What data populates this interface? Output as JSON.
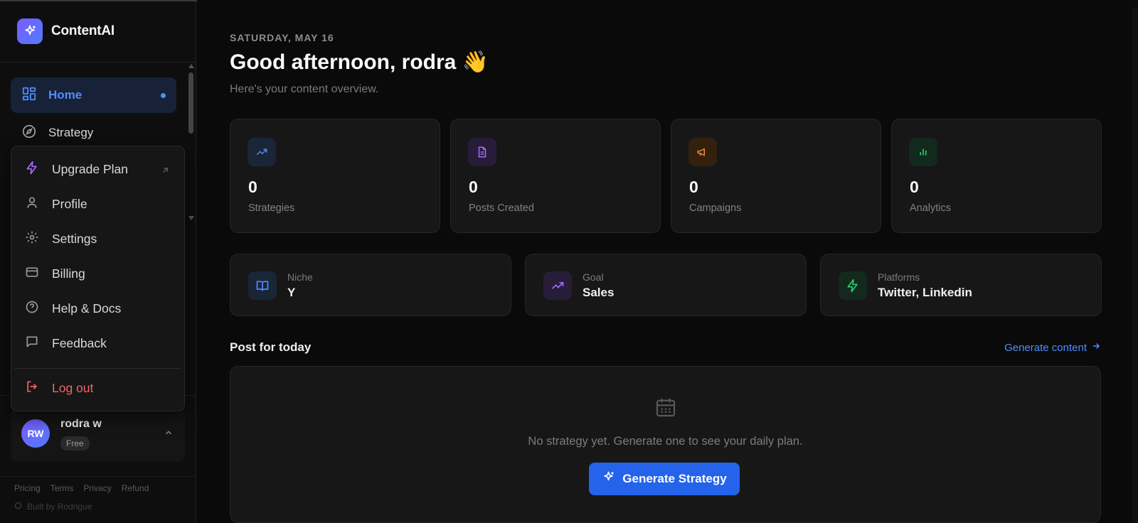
{
  "brand": {
    "name": "ContentAI",
    "logo_icon": "sparkles-icon"
  },
  "nav": {
    "items": [
      {
        "label": "Home",
        "icon": "layout-grid-icon",
        "active": true
      },
      {
        "label": "Strategy",
        "icon": "compass-icon",
        "active": false
      }
    ]
  },
  "menu": {
    "items": [
      {
        "label": "Upgrade Plan",
        "icon": "bolt-icon"
      },
      {
        "label": "Profile",
        "icon": "user-icon"
      },
      {
        "label": "Settings",
        "icon": "gear-icon"
      },
      {
        "label": "Billing",
        "icon": "credit-card-icon"
      },
      {
        "label": "Help & Docs",
        "icon": "help-circle-icon"
      },
      {
        "label": "Feedback",
        "icon": "message-square-icon"
      }
    ],
    "logout": "Log out"
  },
  "user": {
    "initials": "RW",
    "name": "rodra w",
    "plan": "Free"
  },
  "footer": {
    "links": [
      "Pricing",
      "Terms",
      "Privacy",
      "Refund"
    ],
    "built_by": "Built by Rodrigue"
  },
  "header": {
    "date": "SATURDAY, MAY 16",
    "greeting": "Good afternoon, rodra 👋",
    "subtitle": "Here's your content overview."
  },
  "stats": [
    {
      "value": "0",
      "label": "Strategies",
      "icon": "trending-up-icon",
      "color": "#4f8cff"
    },
    {
      "value": "0",
      "label": "Posts Created",
      "icon": "file-text-icon",
      "color": "#a66cff"
    },
    {
      "value": "0",
      "label": "Campaigns",
      "icon": "megaphone-icon",
      "color": "#f08a3c"
    },
    {
      "value": "0",
      "label": "Analytics",
      "icon": "bar-chart-icon",
      "color": "#2ecc71"
    }
  ],
  "info": [
    {
      "label": "Niche",
      "value": "Y",
      "icon": "book-open-icon"
    },
    {
      "label": "Goal",
      "value": "Sales",
      "icon": "trending-up-icon"
    },
    {
      "label": "Platforms",
      "value": "Twitter, Linkedin",
      "icon": "bolt-icon"
    }
  ],
  "today": {
    "title": "Post for today",
    "link": "Generate content",
    "empty_text": "No strategy yet. Generate one to see your daily plan.",
    "button": "Generate Strategy"
  }
}
